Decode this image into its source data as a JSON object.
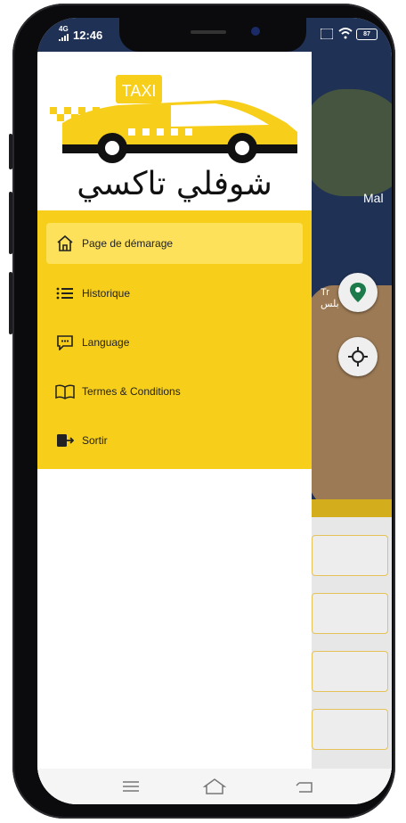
{
  "status_bar": {
    "network": "4G",
    "time": "12:46",
    "battery": "87"
  },
  "map": {
    "label_mal": "Mal",
    "label_tr": "Tr",
    "label_tr_arabic": "بلس"
  },
  "logo": {
    "taxi_text": "TAXI",
    "app_name_arabic": "شوفلي تاكسي"
  },
  "drawer": {
    "items": [
      {
        "label": "Page de démarage",
        "icon": "home-icon"
      },
      {
        "label": "Historique",
        "icon": "list-icon"
      },
      {
        "label": "Language",
        "icon": "message-icon"
      },
      {
        "label": "Termes & Conditions",
        "icon": "book-icon"
      },
      {
        "label": "Sortir",
        "icon": "logout-icon"
      }
    ]
  },
  "colors": {
    "accent": "#f7cf1b",
    "active_item": "#fde15a",
    "map_water": "#1f3154",
    "pin_green": "#1d7a4b"
  },
  "nav_icons": [
    "menu-icon",
    "home-nav-icon",
    "back-icon"
  ]
}
